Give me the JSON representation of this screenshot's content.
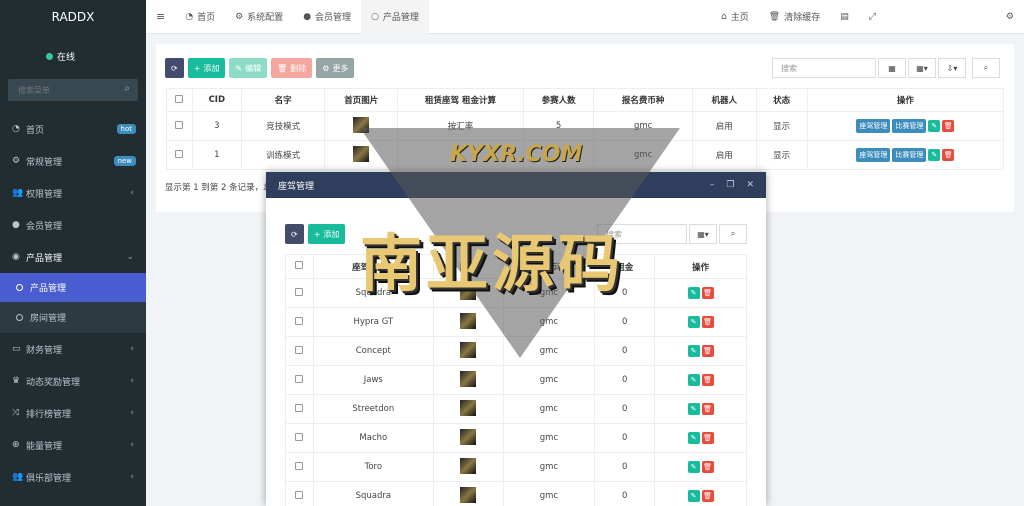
{
  "app": {
    "brand": "RADDX",
    "status": "在线",
    "search_placeholder": "搜索菜单"
  },
  "sidebar": {
    "items": [
      {
        "label": "首页",
        "icon": "dashboard-icon",
        "badge": "hot"
      },
      {
        "label": "常规管理",
        "icon": "gears-icon",
        "badge": "new"
      },
      {
        "label": "权限管理",
        "icon": "users-icon",
        "arrow": "‹"
      },
      {
        "label": "会员管理",
        "icon": "user-icon"
      },
      {
        "label": "产品管理",
        "icon": "product-icon",
        "arrow": "⌄"
      },
      {
        "label": "产品管理",
        "sub": true,
        "active": true
      },
      {
        "label": "房间管理",
        "sub": true
      },
      {
        "label": "财务管理",
        "icon": "credit-card-icon",
        "arrow": "‹"
      },
      {
        "label": "动态奖励管理",
        "icon": "trophy-icon",
        "arrow": "‹"
      },
      {
        "label": "排行榜管理",
        "icon": "random-icon",
        "arrow": "‹"
      },
      {
        "label": "能量管理",
        "icon": "bolt-icon",
        "arrow": "‹"
      },
      {
        "label": "俱乐部管理",
        "icon": "users-icon",
        "arrow": "‹"
      }
    ]
  },
  "topbar": {
    "tabs": [
      "首页",
      "系统配置",
      "会员管理",
      "产品管理"
    ],
    "right": [
      "主页",
      "清除缓存"
    ]
  },
  "toolbar": {
    "add": "添加",
    "edit": "编辑",
    "delete": "删除",
    "more": "更多",
    "search_placeholder": "搜索"
  },
  "main_table": {
    "headers": [
      "CID",
      "名字",
      "首页图片",
      "租赁座驾 租金计算",
      "参赛人数",
      "报名费币种",
      "机器人",
      "状态",
      "操作"
    ],
    "rows": [
      {
        "cid": "3",
        "name": "竞技模式",
        "rent": "按汇率",
        "count": "5",
        "currency": "gmc",
        "robot": "启用",
        "status": "显示",
        "act1": "座驾管理",
        "act2": "比赛管理"
      },
      {
        "cid": "1",
        "name": "训练模式",
        "rent": "",
        "count": "",
        "currency": "gmc",
        "robot": "启用",
        "status": "显示",
        "act1": "座驾管理",
        "act2": "比赛管理"
      }
    ],
    "pager": "显示第 1 到第 2 条记录，总"
  },
  "modal": {
    "title": "座驾管理",
    "toolbar": {
      "add": "添加",
      "search": "搜索"
    },
    "headers": [
      "座驾名中文",
      "图片",
      "租金币种",
      "租金",
      "操作"
    ],
    "rows": [
      {
        "name": "Squadra",
        "currency": "gmc",
        "rent": "0"
      },
      {
        "name": "Hypra GT",
        "currency": "gmc",
        "rent": "0"
      },
      {
        "name": "Concept",
        "currency": "gmc",
        "rent": "0"
      },
      {
        "name": "Jaws",
        "currency": "gmc",
        "rent": "0"
      },
      {
        "name": "Streetdon",
        "currency": "gmc",
        "rent": "0"
      },
      {
        "name": "Macho",
        "currency": "gmc",
        "rent": "0"
      },
      {
        "name": "Toro",
        "currency": "gmc",
        "rent": "0"
      },
      {
        "name": "Squadra",
        "currency": "gmc",
        "rent": "0"
      }
    ]
  },
  "watermark": {
    "url": "KYXR.COM",
    "text": "南亚源码"
  }
}
